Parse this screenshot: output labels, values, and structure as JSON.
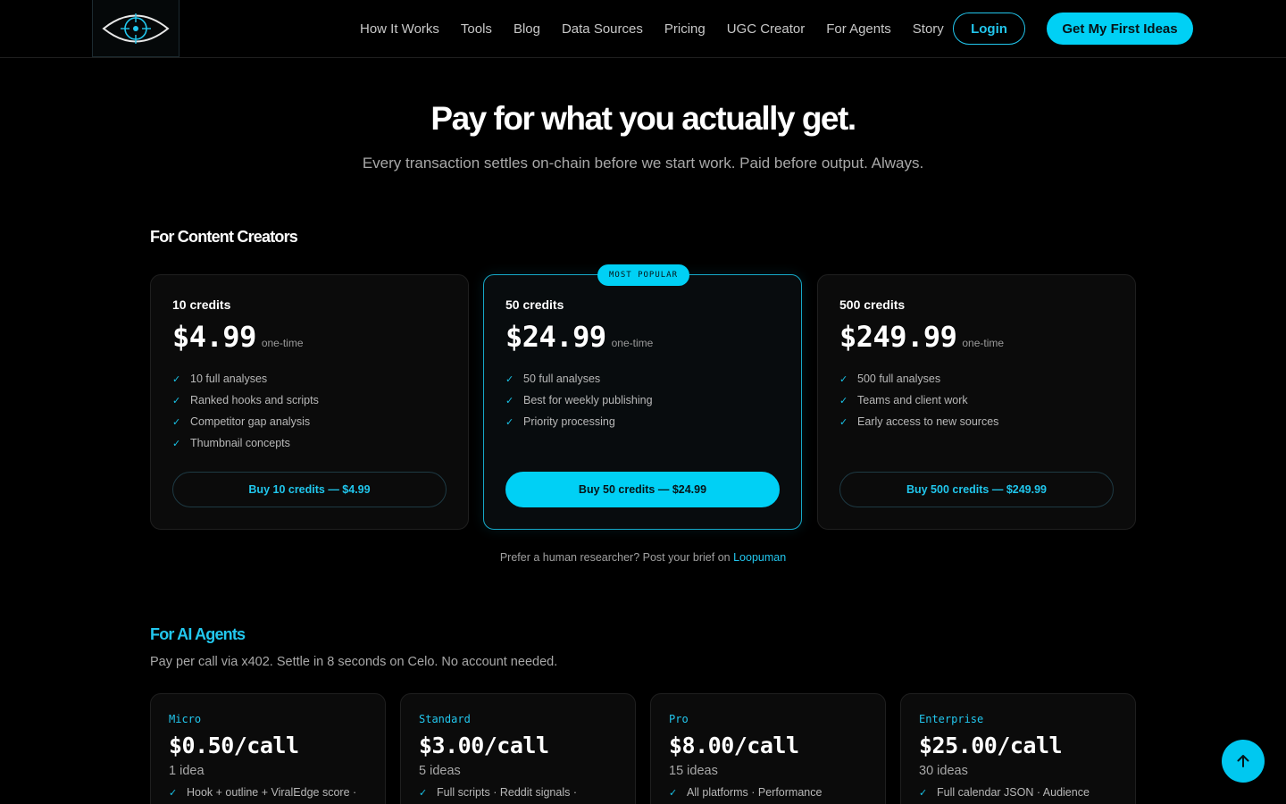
{
  "nav": {
    "items": [
      "How It Works",
      "Tools",
      "Blog",
      "Data Sources",
      "Pricing",
      "UGC Creator",
      "For Agents",
      "Story"
    ],
    "login": "Login",
    "cta": "Get My First Ideas"
  },
  "hero": {
    "title": "Pay for what you actually get.",
    "subtitle": "Every transaction settles on-chain before we start work. Paid before output. Always."
  },
  "creators": {
    "title": "For Content Creators",
    "cards": [
      {
        "name": "10 credits",
        "price": "$4.99",
        "note": "one-time",
        "features": [
          "10 full analyses",
          "Ranked hooks and scripts",
          "Competitor gap analysis",
          "Thumbnail concepts"
        ],
        "button": "Buy 10 credits — $4.99"
      },
      {
        "badge": "MOST POPULAR",
        "name": "50 credits",
        "price": "$24.99",
        "note": "one-time",
        "features": [
          "50 full analyses",
          "Best for weekly publishing",
          "Priority processing"
        ],
        "button": "Buy 50 credits — $24.99"
      },
      {
        "name": "500 credits",
        "price": "$249.99",
        "note": "one-time",
        "features": [
          "500 full analyses",
          "Teams and client work",
          "Early access to new sources"
        ],
        "button": "Buy 500 credits — $249.99"
      }
    ],
    "human_note": "Prefer a human researcher? Post your brief on",
    "human_link": "Loopuman"
  },
  "agents": {
    "title": "For AI Agents",
    "subtitle": "Pay per call via x402. Settle in 8 seconds on Celo. No account needed.",
    "cards": [
      {
        "tier": "Micro",
        "price": "$0.50/call",
        "ideas": "1 idea",
        "feature": "Hook + outline + ViralEdge score ·"
      },
      {
        "tier": "Standard",
        "price": "$3.00/call",
        "ideas": "5 ideas",
        "feature": "Full scripts · Reddit signals ·"
      },
      {
        "tier": "Pro",
        "price": "$8.00/call",
        "ideas": "15 ideas",
        "feature": "All platforms · Performance"
      },
      {
        "tier": "Enterprise",
        "price": "$25.00/call",
        "ideas": "30 ideas",
        "feature": "Full calendar JSON · Audience"
      }
    ]
  },
  "colors": {
    "accent": "#00d0f5",
    "background": "#000000"
  }
}
